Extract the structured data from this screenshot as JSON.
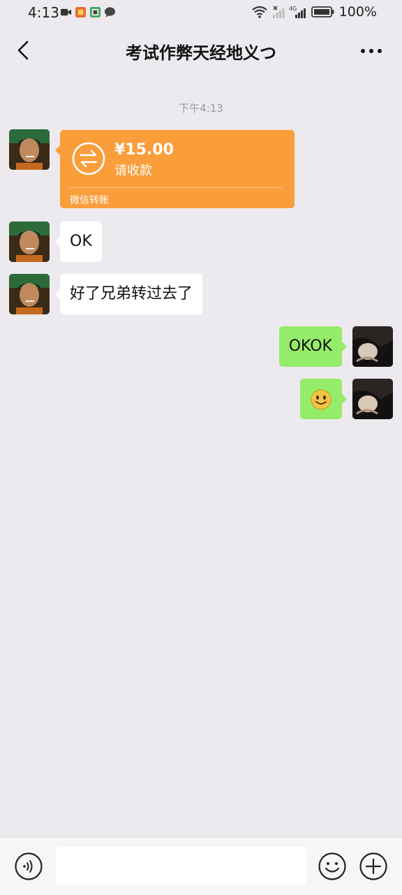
{
  "status_bar": {
    "time": "4:13",
    "battery_text": "100%",
    "network_label": "4G",
    "notification_icons": [
      "video-icon",
      "app-icon",
      "app-icon",
      "chat-icon"
    ]
  },
  "header": {
    "title": "考试作弊天经地义つ"
  },
  "chat": {
    "timestamp": "下午4:13",
    "transfer": {
      "amount": "¥15.00",
      "status": "请收款",
      "footer": "微信转账"
    },
    "messages": [
      {
        "side": "left",
        "text": "OK"
      },
      {
        "side": "left",
        "text": "好了兄弟转过去了"
      },
      {
        "side": "right",
        "text": "OKOK"
      },
      {
        "side": "right",
        "text": "",
        "emoji": "smile-emoji"
      }
    ]
  },
  "colors": {
    "background": "#ECEAEE",
    "transfer_orange": "#FA9D3B",
    "sent_bubble": "#95EC69",
    "received_bubble": "#FFFFFF"
  },
  "input_bar": {
    "placeholder": ""
  }
}
